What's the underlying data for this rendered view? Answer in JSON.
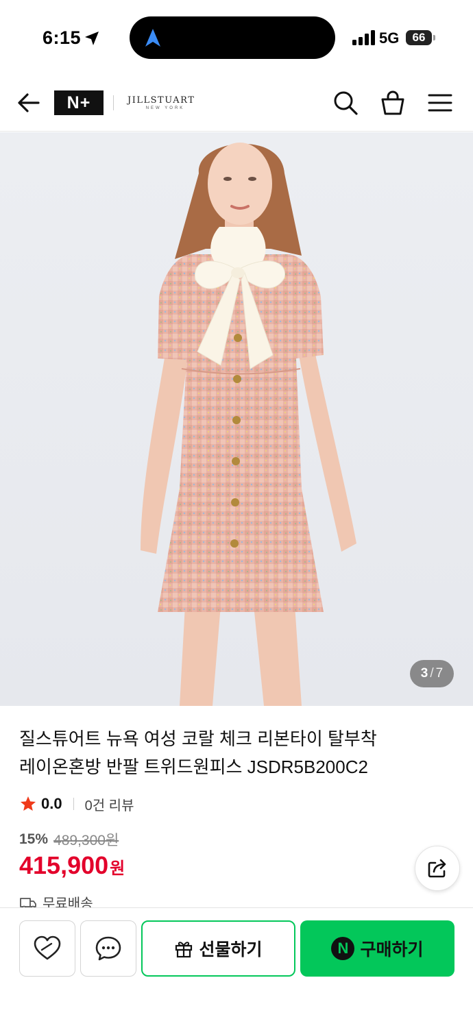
{
  "status_bar": {
    "time": "6:15",
    "network": "5G",
    "battery": "66"
  },
  "header": {
    "platform_logo": "N+",
    "brand_logo_main": "JILLSTUART",
    "brand_logo_sub": "NEW YORK"
  },
  "gallery": {
    "current": "3",
    "separator": "/",
    "total": "7"
  },
  "product": {
    "title_line1": "질스튜어트 뉴욕 여성 코랄 체크 리본타이 탈부착",
    "title_line2": "레이온혼방 반팔 트위드원피스 JSDR5B200C2",
    "rating": "0.0",
    "review_count": "0건 리뷰",
    "discount_rate": "15%",
    "original_price": "489,300원",
    "sale_price": "415,900",
    "currency": "원",
    "shipping": "무료배송"
  },
  "actions": {
    "gift_label": "선물하기",
    "buy_label": "구매하기",
    "buy_badge": "N"
  },
  "colors": {
    "accent_green": "#03c75a",
    "price_red": "#e3002b",
    "star_red": "#ef3a1a"
  },
  "icons": [
    "location-arrow-icon",
    "navigation-icon",
    "signal-icon",
    "battery-icon",
    "back-arrow-icon",
    "search-icon",
    "shopping-bag-icon",
    "hamburger-menu-icon",
    "star-icon",
    "share-icon",
    "truck-icon",
    "heart-icon",
    "chat-bubble-icon",
    "gift-icon",
    "npay-icon"
  ]
}
